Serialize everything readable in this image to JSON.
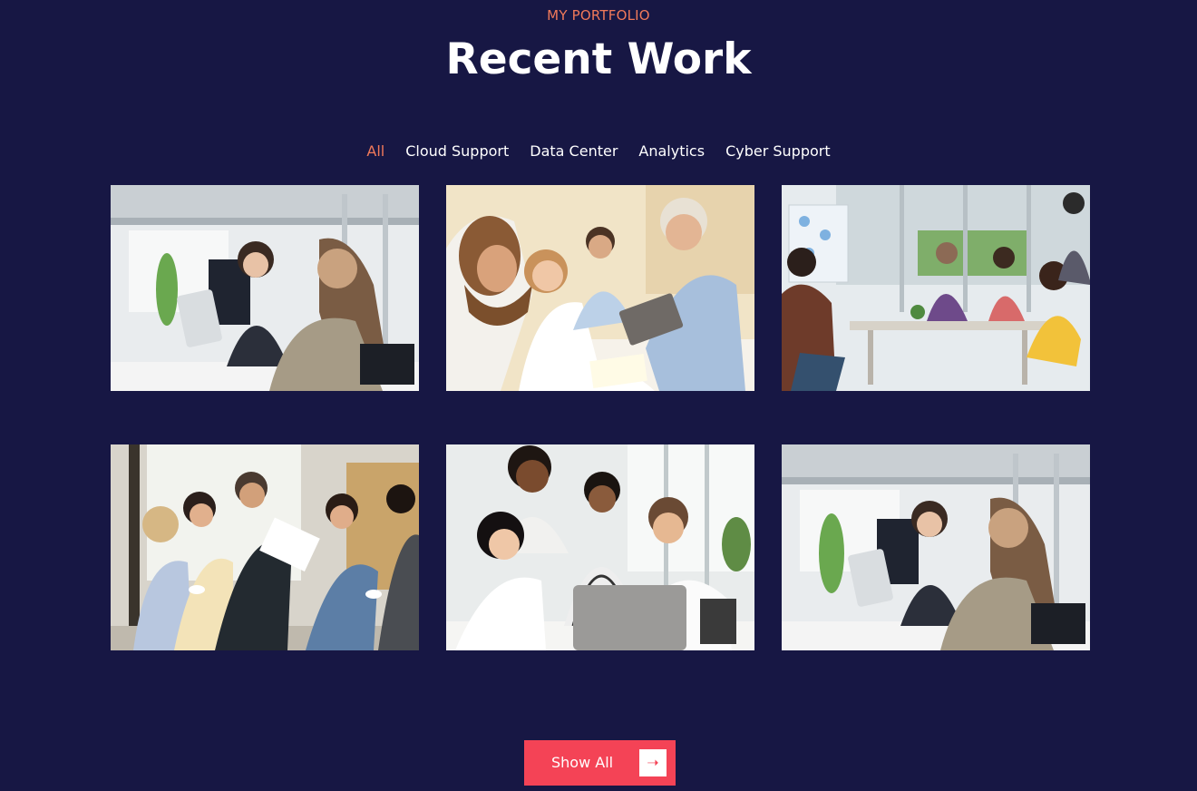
{
  "header": {
    "eyebrow": "MY PORTFOLIO",
    "title": "Recent Work"
  },
  "filters": [
    {
      "label": "All",
      "active": true
    },
    {
      "label": "Cloud Support",
      "active": false
    },
    {
      "label": "Data Center",
      "active": false
    },
    {
      "label": "Analytics",
      "active": false
    },
    {
      "label": "Cyber Support",
      "active": false
    }
  ],
  "portfolio_items": [
    {
      "scene": "two-women-tablet-meeting"
    },
    {
      "scene": "team-around-laptop-discussion"
    },
    {
      "scene": "office-team-applauding-at-table"
    },
    {
      "scene": "colleagues-standing-with-coffee"
    },
    {
      "scene": "excited-team-at-laptop"
    },
    {
      "scene": "two-women-tablet-meeting"
    }
  ],
  "show_all": {
    "label": "Show All",
    "icon": "arrow-right-icon"
  },
  "colors": {
    "background": "#171744",
    "accent": "#f0795a",
    "button": "#f44356",
    "text": "#ffffff"
  }
}
